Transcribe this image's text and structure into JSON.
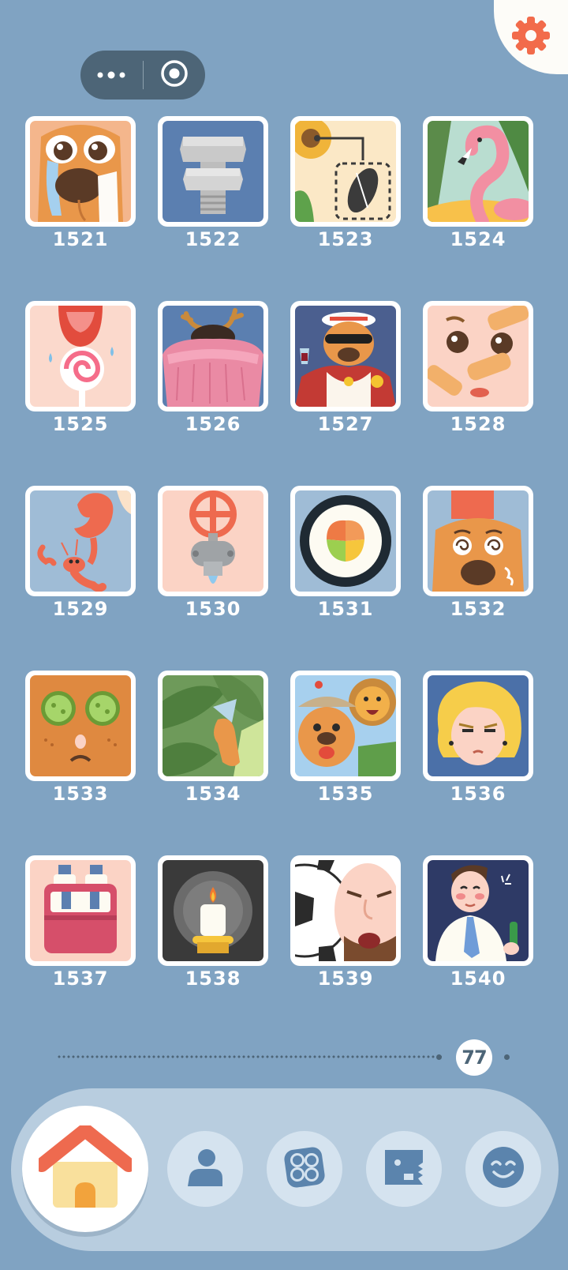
{
  "header": {
    "settings_icon": "gear-icon",
    "capsule": {
      "more_icon": "more-dots-icon",
      "close_icon": "target-close-icon"
    }
  },
  "levels": [
    {
      "number": "1521",
      "icon": "crying-dog-icon"
    },
    {
      "number": "1522",
      "icon": "bolt-nut-icon"
    },
    {
      "number": "1523",
      "icon": "sunflower-seed-icon"
    },
    {
      "number": "1524",
      "icon": "flamingo-icon"
    },
    {
      "number": "1525",
      "icon": "lollipop-mouth-icon"
    },
    {
      "number": "1526",
      "icon": "pink-sweater-antlers-icon"
    },
    {
      "number": "1527",
      "icon": "rich-tiger-icon"
    },
    {
      "number": "1528",
      "icon": "bandaged-face-icon"
    },
    {
      "number": "1529",
      "icon": "lobster-icon"
    },
    {
      "number": "1530",
      "icon": "faucet-valve-icon"
    },
    {
      "number": "1531",
      "icon": "sushi-roll-icon"
    },
    {
      "number": "1532",
      "icon": "dizzy-dog-icon"
    },
    {
      "number": "1533",
      "icon": "cucumber-mask-icon"
    },
    {
      "number": "1534",
      "icon": "leaf-hidden-icon"
    },
    {
      "number": "1535",
      "icon": "tiger-lion-icon"
    },
    {
      "number": "1536",
      "icon": "blonde-guy-icon"
    },
    {
      "number": "1537",
      "icon": "red-box-icon"
    },
    {
      "number": "1538",
      "icon": "candle-icon"
    },
    {
      "number": "1539",
      "icon": "soccer-face-icon"
    },
    {
      "number": "1540",
      "icon": "drunk-man-icon"
    }
  ],
  "pagination": {
    "page": "77"
  },
  "nav": [
    {
      "name": "home",
      "icon": "home-icon"
    },
    {
      "name": "profile",
      "icon": "person-icon"
    },
    {
      "name": "collection",
      "icon": "grid-dots-icon"
    },
    {
      "name": "monster",
      "icon": "monster-icon"
    },
    {
      "name": "emoji",
      "icon": "smile-icon"
    }
  ],
  "colors": {
    "background": "#80a3c2",
    "accent": "#f26b4b",
    "dark": "#4d6577"
  }
}
